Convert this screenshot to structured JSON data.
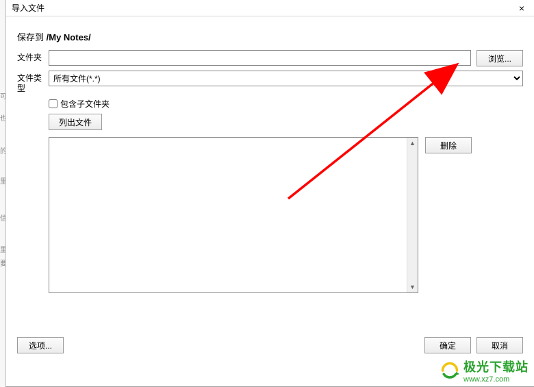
{
  "titlebar": {
    "title": "导入文件",
    "close_label": "×"
  },
  "save_to": {
    "label": "保存到 ",
    "path": "/My Notes/"
  },
  "folder": {
    "label": "文件夹",
    "value": "",
    "browse_label": "浏览..."
  },
  "filetype": {
    "label": "文件类型",
    "selected": "所有文件(*.*)"
  },
  "subfolders": {
    "label": "包含子文件夹",
    "checked": false
  },
  "list_files_button": "列出文件",
  "delete_button": "删除",
  "options_button": "选项...",
  "ok_button": "确定",
  "cancel_button": "取消",
  "watermark": {
    "brand": "极光下载站",
    "url": "www.xz7.com"
  },
  "arrow_color": "#ff0000"
}
